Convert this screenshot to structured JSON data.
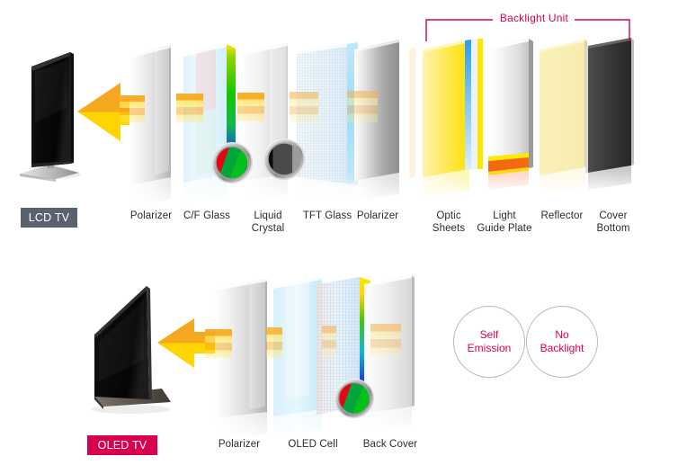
{
  "diagram": {
    "title": "LCD TV and OLED TV panel structure comparison",
    "colors": {
      "lcd_badge_bg": "#59636f",
      "oled_badge_bg": "#d9004f",
      "accent_pink": "#d9004f",
      "arrow_orange": "#f5a623",
      "arrow_yellow": "#ffd400",
      "label_text": "#2b2b2b",
      "circle_border": "#b9b9b9"
    }
  },
  "lcd_section": {
    "tv_badge": "LCD TV",
    "tv_name": "lcd-tv-illustration",
    "arrow_name": "light-direction-arrow",
    "backlight_bracket": {
      "label": "Backlight Unit"
    },
    "layers": [
      {
        "id": "polarizer-front",
        "label": "Polarizer"
      },
      {
        "id": "cf-glass",
        "label": "C/F Glass"
      },
      {
        "id": "liquid-crystal",
        "label": "Liquid\nCrystal"
      },
      {
        "id": "tft-glass",
        "label": "TFT Glass"
      },
      {
        "id": "polarizer-rear",
        "label": "Polarizer"
      },
      {
        "id": "optic-sheets",
        "label": "Optic\nSheets"
      },
      {
        "id": "light-guide-plate",
        "label": "Light\nGuide Plate"
      },
      {
        "id": "reflector",
        "label": "Reflector"
      },
      {
        "id": "cover-bottom",
        "label": "Cover\nBottom"
      }
    ],
    "markers": [
      {
        "id": "rgb-subpixel-marker",
        "kind": "rgb-stripes"
      },
      {
        "id": "grayscale-shutter-marker",
        "kind": "gray-stripes"
      }
    ]
  },
  "oled_section": {
    "tv_badge": "OLED TV",
    "tv_name": "oled-tv-illustration",
    "arrow_name": "light-direction-arrow",
    "layers": [
      {
        "id": "polarizer",
        "label": "Polarizer"
      },
      {
        "id": "oled-cell",
        "label": "OLED Cell"
      },
      {
        "id": "back-cover",
        "label": "Back Cover"
      }
    ],
    "markers": [
      {
        "id": "rgb-subpixel-marker",
        "kind": "rgb-stripes"
      }
    ],
    "notes": [
      {
        "id": "self-emission",
        "label": "Self\nEmission"
      },
      {
        "id": "no-backlight",
        "label": "No\nBacklight"
      }
    ]
  }
}
